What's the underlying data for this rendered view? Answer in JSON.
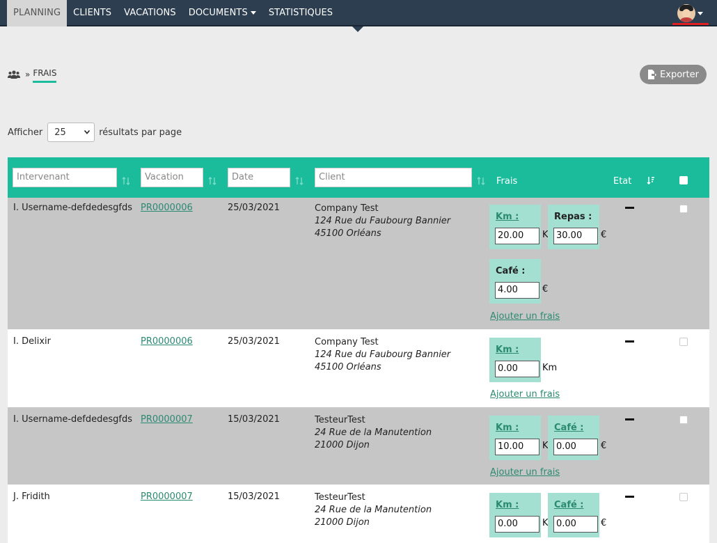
{
  "nav": {
    "items": [
      {
        "label": "PLANNING",
        "active": true,
        "dropdown": false
      },
      {
        "label": "CLIENTS",
        "active": false,
        "dropdown": false
      },
      {
        "label": "VACATIONS",
        "active": false,
        "dropdown": false
      },
      {
        "label": "DOCUMENTS",
        "active": false,
        "dropdown": true
      },
      {
        "label": "STATISTIQUES",
        "active": false,
        "dropdown": false
      }
    ],
    "user_avatar": "user-avatar"
  },
  "breadcrumb": {
    "icon": "users-icon",
    "separator": "»",
    "current": "FRAIS"
  },
  "export_button": {
    "label": "Exporter",
    "icon": "file-export-icon"
  },
  "length": {
    "prefix": "Afficher",
    "value": "25",
    "suffix": "résultats par page"
  },
  "table": {
    "filters": {
      "intervenant": "Intervenant",
      "vacation": "Vacation",
      "date": "Date",
      "client": "Client"
    },
    "headers": {
      "frais": "Frais",
      "etat": "Etat"
    },
    "add_frais_label": "Ajouter un frais",
    "rows": [
      {
        "name": "I. Username-defdedesgfds",
        "vacation": "PR0000006",
        "date": "25/03/2021",
        "client_name": "Company Test",
        "client_street": "124 Rue du Faubourg Bannier",
        "client_city": "45100 Orléans",
        "frais": [
          {
            "label": "Km :",
            "value": "20.00",
            "unit": "K",
            "link": true
          },
          {
            "label": "Repas :",
            "value": "30.00",
            "unit": "€",
            "link": false
          },
          {
            "label": "Café :",
            "value": "4.00",
            "unit": "€",
            "link": false
          }
        ]
      },
      {
        "name": "I. Delixir",
        "vacation": "PR0000006",
        "date": "25/03/2021",
        "client_name": "Company Test",
        "client_street": "124 Rue du Faubourg Bannier",
        "client_city": "45100 Orléans",
        "frais": [
          {
            "label": "Km :",
            "value": "0.00",
            "unit": "Km",
            "link": true
          }
        ]
      },
      {
        "name": "I. Username-defdedesgfds",
        "vacation": "PR0000007",
        "date": "15/03/2021",
        "client_name": "TesteurTest",
        "client_street": "24 Rue de la Manutention",
        "client_city": "21000 Dijon",
        "frais": [
          {
            "label": "Km :",
            "value": "10.00",
            "unit": "K",
            "link": true
          },
          {
            "label": "Café :",
            "value": "0.00",
            "unit": "€",
            "link": true
          }
        ]
      },
      {
        "name": "J. Fridith",
        "vacation": "PR0000007",
        "date": "15/03/2021",
        "client_name": "TesteurTest",
        "client_street": "24 Rue de la Manutention",
        "client_city": "21000 Dijon",
        "frais": [
          {
            "label": "Km :",
            "value": "0.00",
            "unit": "K",
            "link": true
          },
          {
            "label": "Café :",
            "value": "0.00",
            "unit": "€",
            "link": true
          }
        ]
      }
    ]
  },
  "colors": {
    "navbar": "#2c3e50",
    "accent": "#1abc9c",
    "frais_box": "#a3e0d2",
    "link": "#2a8a70"
  }
}
